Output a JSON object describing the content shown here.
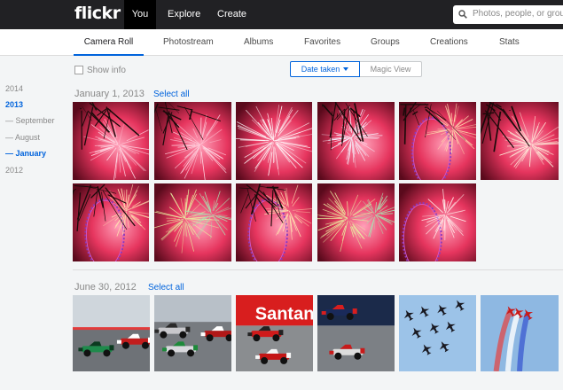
{
  "header": {
    "logo": "flickr",
    "nav": [
      {
        "label": "You",
        "active": true
      },
      {
        "label": "Explore",
        "active": false
      },
      {
        "label": "Create",
        "active": false
      }
    ],
    "search_placeholder": "Photos, people, or groups"
  },
  "subnav": {
    "tabs": [
      {
        "label": "Camera Roll",
        "active": true
      },
      {
        "label": "Photostream",
        "active": false
      },
      {
        "label": "Albums",
        "active": false
      },
      {
        "label": "Favorites",
        "active": false
      },
      {
        "label": "Groups",
        "active": false
      },
      {
        "label": "Creations",
        "active": false
      },
      {
        "label": "Stats",
        "active": false
      }
    ]
  },
  "toolbar": {
    "show_info_label": "Show info",
    "show_info_checked": false,
    "date_taken_label": "Date taken",
    "magic_view_label": "Magic View"
  },
  "timeline": [
    {
      "label": "2014",
      "active": false
    },
    {
      "label": "2013",
      "active": true
    },
    {
      "label": "— September",
      "active": false
    },
    {
      "label": "— August",
      "active": false
    },
    {
      "label": "— January",
      "active": true
    },
    {
      "label": "2012",
      "active": false
    }
  ],
  "sections": [
    {
      "date": "January 1, 2013",
      "select_all": "Select all",
      "photos": [
        {
          "theme": "fireworks-pink-tree"
        },
        {
          "theme": "fireworks-pink-tree"
        },
        {
          "theme": "fireworks-pink-burst"
        },
        {
          "theme": "fireworks-white-wheel"
        },
        {
          "theme": "london-eye-fireworks"
        },
        {
          "theme": "fireworks-gold-tree"
        },
        {
          "theme": "london-eye-fireworks"
        },
        {
          "theme": "fireworks-green-gold"
        },
        {
          "theme": "london-eye-fireworks"
        },
        {
          "theme": "fireworks-green-gold"
        },
        {
          "theme": "fireworks-smoke-eye"
        }
      ]
    },
    {
      "date": "June 30, 2012",
      "select_all": "Select all",
      "photos": [
        {
          "theme": "f1-green-car"
        },
        {
          "theme": "f1-silver-cars"
        },
        {
          "theme": "f1-santander-ferrari"
        },
        {
          "theme": "f1-redbull-mclaren"
        },
        {
          "theme": "red-arrows-formation"
        },
        {
          "theme": "red-arrows-smoke"
        }
      ]
    }
  ],
  "colors": {
    "accent": "#0063dc",
    "topbar": "#212124",
    "background": "#f3f5f6"
  }
}
